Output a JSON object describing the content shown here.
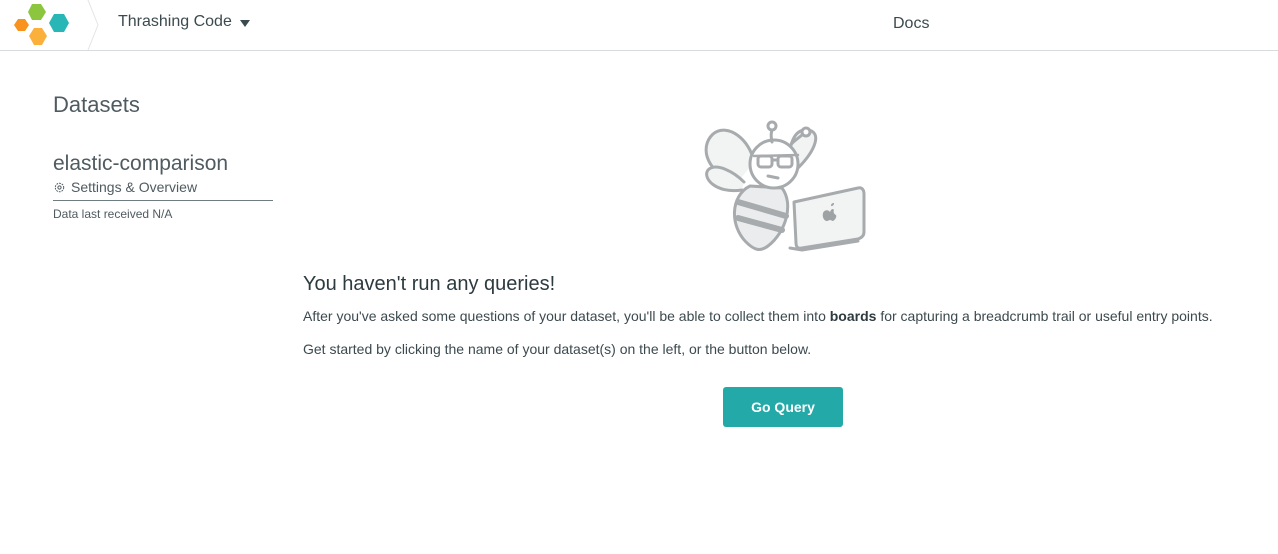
{
  "header": {
    "team_name": "Thrashing Code",
    "docs_label": "Docs"
  },
  "sidebar": {
    "title": "Datasets",
    "datasets": [
      {
        "name": "elastic-comparison",
        "settings_label": "Settings & Overview",
        "last_received": "Data last received N/A"
      }
    ]
  },
  "main": {
    "empty_title": "You haven't run any queries!",
    "empty_body_pre": "After you've asked some questions of your dataset, you'll be able to collect them into ",
    "empty_body_bold": "boards",
    "empty_body_post": " for capturing a breadcrumb trail or useful entry points.",
    "empty_body2": "Get started by clicking the name of your dataset(s) on the left, or the button below.",
    "cta_label": "Go Query"
  },
  "colors": {
    "accent": "#24a9a9",
    "logo_green": "#8cc63f",
    "logo_orange": "#f7931e",
    "logo_teal": "#29b6b6",
    "logo_yellow": "#fbb03b"
  }
}
